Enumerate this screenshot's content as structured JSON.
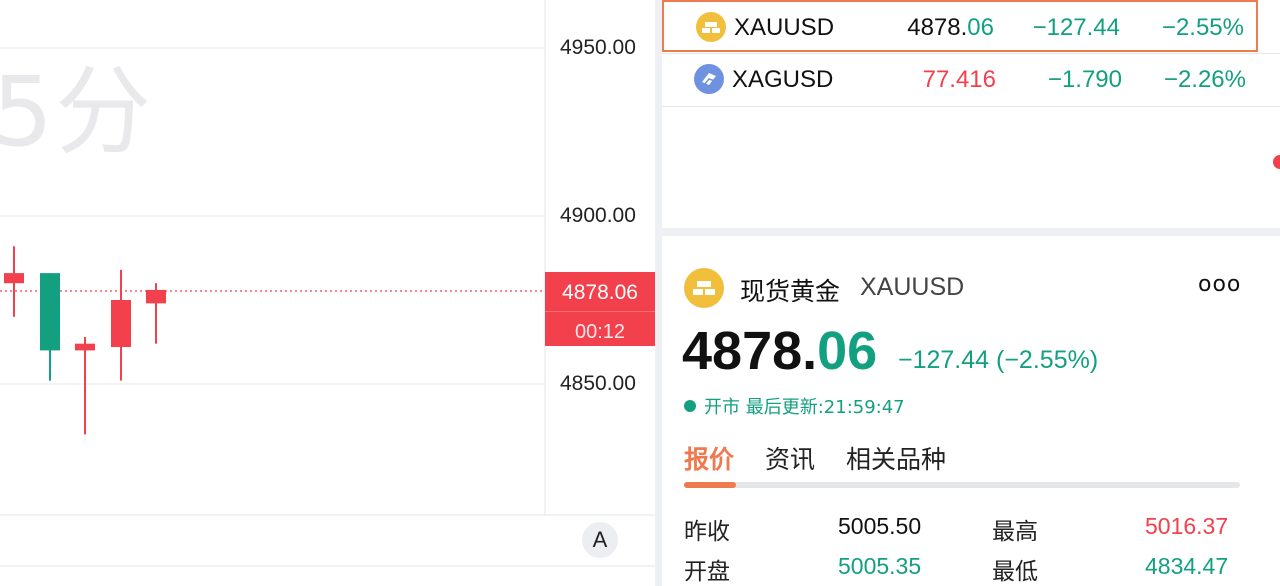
{
  "chart": {
    "period_watermark": "5分",
    "y_axis": [
      "4950.00",
      "4900.00",
      "4850.00"
    ],
    "current_price": "4878.06",
    "countdown": "00:12",
    "auto_button": "A",
    "candles": [
      {
        "open": 4880,
        "close": 4883,
        "high": 4891,
        "low": 4870
      },
      {
        "open": 4883,
        "close": 4860,
        "high": 4883,
        "low": 4851
      },
      {
        "open": 4860,
        "close": 4862,
        "high": 4864,
        "low": 4835
      },
      {
        "open": 4861,
        "close": 4875,
        "high": 4884,
        "low": 4851
      },
      {
        "open": 4874,
        "close": 4878,
        "high": 4880,
        "low": 4862
      }
    ],
    "colors": {
      "up": "#f2404c",
      "down": "#13a080",
      "grid": "#e8e9ec"
    }
  },
  "watchlist": [
    {
      "coin_icon": "gold-bars-icon",
      "symbol": "XAUUSD",
      "price_int": "4878.",
      "price_dec": "06",
      "change": "−127.44",
      "change_pct": "−2.55%",
      "selected": true
    },
    {
      "coin_icon": "silver-bars-icon",
      "symbol": "XAGUSD",
      "price_int": "77.416",
      "price_dec": "",
      "change": "−1.790",
      "change_pct": "−2.26%",
      "selected": false
    }
  ],
  "detail": {
    "name": "现货黄金",
    "code": "XAUUSD",
    "more": "ooo",
    "price_int": "4878.",
    "price_dec": "06",
    "change": "−127.44 (−2.55%)",
    "status": "开市 最后更新:21:59:47",
    "tabs": [
      "报价",
      "资讯",
      "相关品种"
    ],
    "stats": {
      "prev_close_label": "昨收",
      "prev_close": "5005.50",
      "high_label": "最高",
      "high": "5016.37",
      "open_label": "开盘",
      "open": "5005.35",
      "low_label": "最低",
      "low": "4834.47"
    }
  }
}
